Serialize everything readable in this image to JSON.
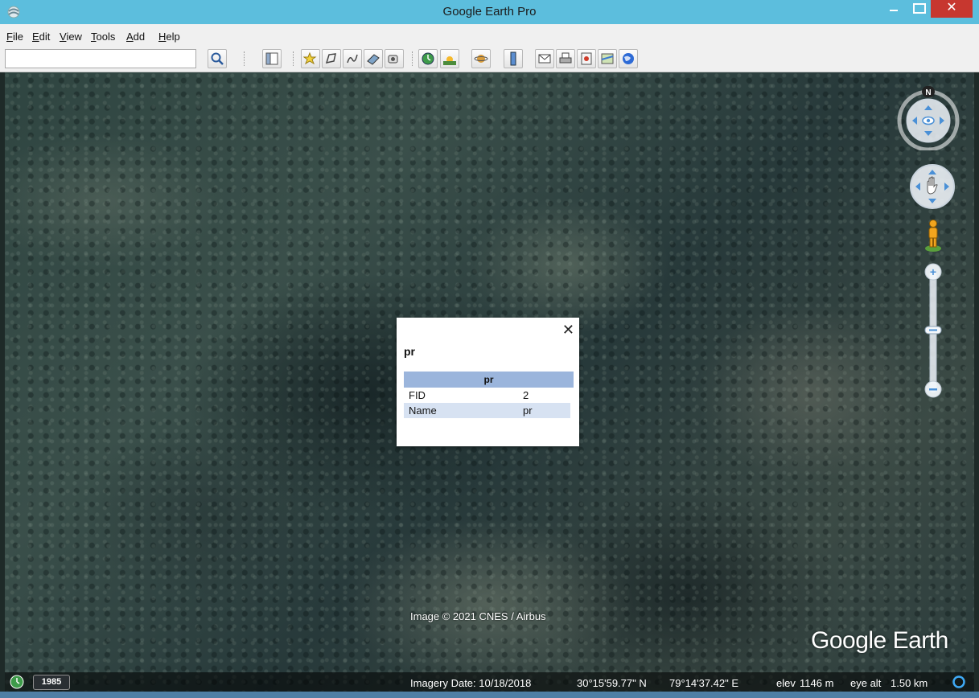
{
  "window": {
    "title": "Google Earth Pro",
    "close_glyph": "✕"
  },
  "menu": {
    "items": [
      {
        "mnemonic": "F",
        "rest": "ile"
      },
      {
        "mnemonic": "E",
        "rest": "dit"
      },
      {
        "mnemonic": "V",
        "rest": "iew"
      },
      {
        "mnemonic": "T",
        "rest": "ools"
      },
      {
        "mnemonic": "A",
        "rest": "dd"
      },
      {
        "mnemonic": "H",
        "rest": "elp"
      }
    ]
  },
  "search": {
    "value": "",
    "placeholder": ""
  },
  "toolbar": {
    "icons": [
      "search-icon",
      "sidebar-toggle-icon",
      "add-placemark-icon",
      "add-polygon-icon",
      "add-path-icon",
      "add-image-overlay-icon",
      "record-tour-icon",
      "historical-imagery-icon",
      "sunlight-icon",
      "switch-planet-icon",
      "ruler-icon",
      "email-icon",
      "print-icon",
      "save-image-icon",
      "view-in-maps-icon",
      "earth-gallery-icon"
    ]
  },
  "balloon": {
    "close": "✕",
    "title": "pr",
    "table_header": "pr",
    "rows": [
      {
        "key": "FID",
        "value": "2"
      },
      {
        "key": "Name",
        "value": "pr"
      }
    ]
  },
  "navigation": {
    "north_label": "N"
  },
  "map": {
    "copyright": "Image © 2021 CNES / Airbus",
    "logo": "Google Earth"
  },
  "status": {
    "history_year": "1985",
    "imagery_date": "Imagery Date: 10/18/2018",
    "latitude": "30°15'59.77\" N",
    "longitude": "79°14'37.42\" E",
    "elev_label": "elev",
    "elevation": "1146 m",
    "eye_alt_label": "eye alt",
    "eye_alt": "1.50 km"
  },
  "colors": {
    "titlebar": "#5cbedd",
    "close_button": "#c7372f",
    "balloon_header": "#9bb5dc",
    "balloon_alt_row": "#d7e2f2"
  }
}
